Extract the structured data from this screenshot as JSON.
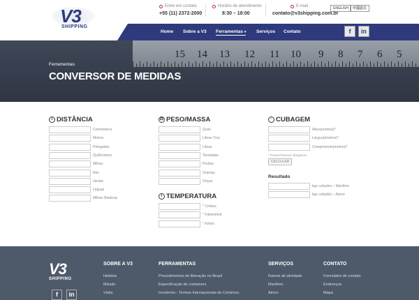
{
  "header": {
    "logo_text": "V3",
    "logo_sub": "SHIPPING",
    "contact_label": "Entre em contato",
    "contact_value": "+55 (11) 2372-2000",
    "hours_label": "Horário de atendimento",
    "hours_value": "8:30 – 18:00",
    "email_label": "E-mail",
    "email_value": "contato@v3shipping.com.br",
    "lang_en": "ENGLISH",
    "lang_zh": "中國語文"
  },
  "nav": {
    "items": [
      "Home",
      "Sobre a V3",
      "Ferramentas",
      "Serviços",
      "Contato"
    ],
    "social_fb": "f",
    "social_in": "in"
  },
  "banner": {
    "crumb": "Ferramentas",
    "title": "CONVERSOR DE MEDIDAS",
    "ruler_numbers": [
      "15",
      "14",
      "13",
      "12",
      "11",
      "10",
      "9",
      "8",
      "7",
      "6",
      "5"
    ]
  },
  "distancia": {
    "title": "DISTÂNCIA",
    "units": [
      "Centímetros",
      "Metros",
      "Polegadas",
      "Quilômetros",
      "Milhas",
      "Nós",
      "Jardas",
      "Léguas",
      "Milhas Náuticas"
    ]
  },
  "peso": {
    "title": "PESO/MASSA",
    "units": [
      "Quilo",
      "Libras Troy",
      "Libras",
      "Toneladas",
      "Pedras",
      "Gramas",
      "Onças"
    ]
  },
  "temperatura": {
    "title": "TEMPERATURA",
    "units": [
      "° Celsius",
      "° Fahrenheit",
      "° Kelvin"
    ]
  },
  "cubagem": {
    "title": "CUBAGEM",
    "fields": [
      "Altura(metros)*",
      "Largura(metros)*",
      "Comprimento(metros)*"
    ],
    "hint": "* Preenchimento obrigatório",
    "button": "CALCULAR",
    "result_title": "Resultado",
    "results": [
      "kgs cubados – Marítimo",
      "kgs cubados – Aéreo"
    ]
  },
  "footer": {
    "logo_text": "V3",
    "logo_sub": "SHIPPING",
    "col1_head": "SOBRE A V3",
    "col1_links": [
      "História",
      "Missão",
      "Visão"
    ],
    "col2_head": "FERRAMENTAS",
    "col2_links": [
      "Procedimentos de liberação no Brasil",
      "Especificação de containers",
      "Incoterms - Termos Internacionais de Comércio"
    ],
    "col3_head": "SERVIÇOS",
    "col3_links": [
      "Ramos de atividade",
      "Marítimo",
      "Aéreo"
    ],
    "col4_head": "CONTATO",
    "col4_links": [
      "Formulário de contato",
      "Endereços",
      "Mapa"
    ],
    "social_fb": "f",
    "social_in": "in"
  },
  "colors": {
    "brand": "#2e3a7c",
    "footer_bg": "#4e5a6a",
    "accent_red": "#c8232c"
  }
}
